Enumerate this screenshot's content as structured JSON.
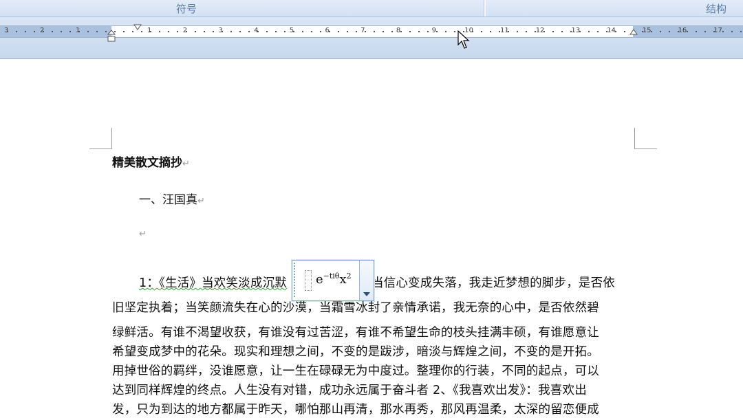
{
  "ribbon": {
    "group_symbols": "符号",
    "group_structure": "结构"
  },
  "ruler": {
    "left_numbers": [
      "3",
      "2",
      "1",
      "1"
    ],
    "right_numbers": [
      "1",
      "2",
      "3",
      "4",
      "5",
      "6",
      "7",
      "8",
      "9",
      "10",
      "11",
      "12",
      "13",
      "14",
      "15",
      "16",
      "17"
    ]
  },
  "document": {
    "title": "精美散文摘抄",
    "heading1": "一、汪国真",
    "paragraph_mark": "↵",
    "equation": {
      "base": "e",
      "exponent": "−tiθ",
      "var": "x",
      "var_exponent": "2"
    },
    "line1_a": "1：《生活》当欢笑淡成沉默",
    "line1_b": "当信心变成失落，我走近梦想的脚步，是否依",
    "lines": [
      "旧坚定执着；当笑颜流失在心的沙漠，当霜雪冰封了亲情承诺，我无奈的心中，是否依然碧",
      "绿鲜活。有谁不渴望收获，有谁没有过苦涩，有谁不希望生命的枝头挂满丰硕，有谁愿意让",
      "希望变成梦中的花朵。现实和理想之间，不变的是跋涉，暗淡与辉煌之间，不变的是开拓。",
      "用掉世俗的羁绊，没谁愿意，让一生在碌碌无为中度过。整理你的行装，不同的起点，可以",
      "达到同样辉煌的终点。人生没有对错，成功永远属于奋斗者 2、《我喜欢出发》：我喜欢出",
      "发，只为到达的地方都属于昨天，哪怕那山再清，那水再秀，那风再温柔，太深的留恋便成"
    ]
  },
  "icons": {
    "cursor": "mouse-pointer-icon",
    "dropdown": "chevron-down-icon"
  }
}
